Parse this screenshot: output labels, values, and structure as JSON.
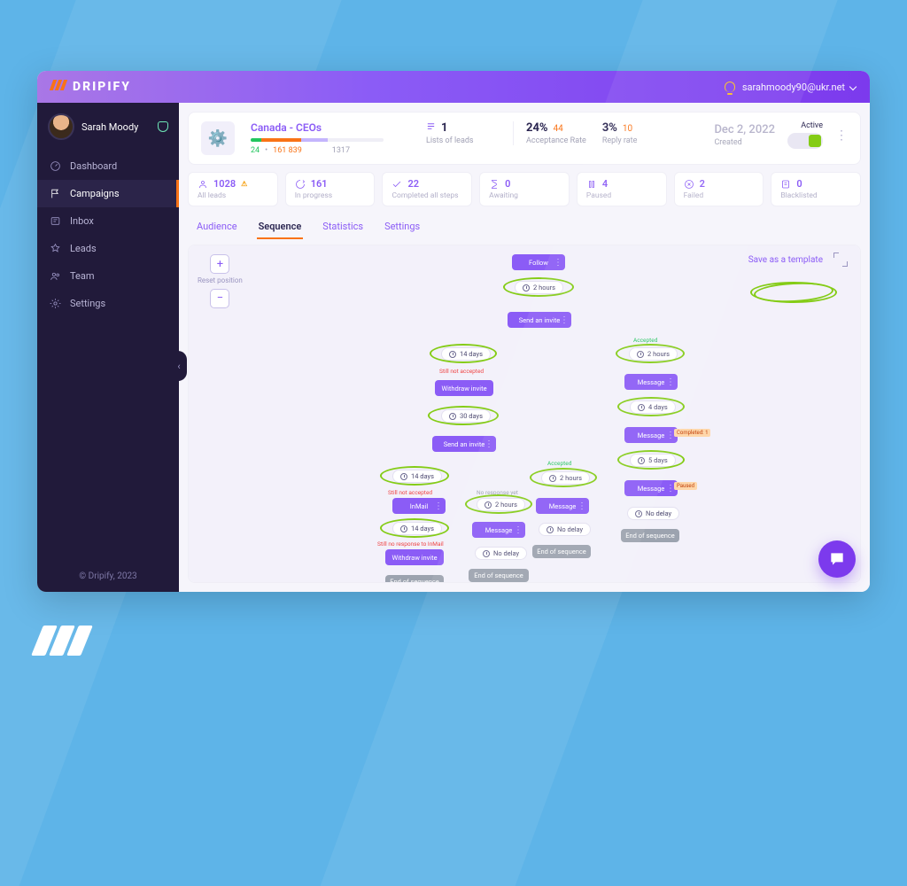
{
  "brand": "DRIPIFY",
  "user_email": "sarahmoody90@ukr.net",
  "profile": {
    "name": "Sarah Moody"
  },
  "sidebar": {
    "items": [
      {
        "label": "Dashboard"
      },
      {
        "label": "Campaigns"
      },
      {
        "label": "Inbox"
      },
      {
        "label": "Leads"
      },
      {
        "label": "Team"
      },
      {
        "label": "Settings"
      }
    ]
  },
  "copyright": "© Dripify, 2023",
  "campaign": {
    "title": "Canada - CEOs",
    "counts": {
      "green": "24",
      "orange": "161 839",
      "grey": "1317"
    },
    "lists": {
      "value": "1",
      "label": "Lists of leads"
    },
    "acceptance": {
      "pct": "24%",
      "sub": "44",
      "label": "Acceptance Rate"
    },
    "reply": {
      "pct": "3%",
      "sub": "10",
      "label": "Reply rate"
    },
    "created": {
      "date": "Dec 2, 2022",
      "label": "Created"
    },
    "status_label": "Active"
  },
  "chips": [
    {
      "value": "1028",
      "label": "All leads"
    },
    {
      "value": "161",
      "label": "In progress"
    },
    {
      "value": "22",
      "label": "Completed all steps"
    },
    {
      "value": "0",
      "label": "Awaiting"
    },
    {
      "value": "4",
      "label": "Paused"
    },
    {
      "value": "2",
      "label": "Failed"
    },
    {
      "value": "0",
      "label": "Blacklisted"
    }
  ],
  "tabs": [
    "Audience",
    "Sequence",
    "Statistics",
    "Settings"
  ],
  "canvas": {
    "reset_label": "Reset position",
    "save_template": "Save as a template"
  },
  "nodes": {
    "follow": "Follow",
    "d2h": "2 hours",
    "invite": "Send an invite",
    "accepted": "Accepted",
    "d14": "14 days",
    "not_accepted": "Still not accepted",
    "withdraw": "Withdraw invite",
    "d30": "30 days",
    "invite2": "Send an invite",
    "accepted2": "Accepted",
    "d14b": "14 days",
    "na2": "Still not accepted",
    "inmail": "InMail",
    "d14c": "14 days",
    "na3": "Still no response to InMail",
    "withdraw2": "Withdraw invite",
    "eos": "End of sequence",
    "nr2": "No response yet",
    "d2h2": "2 hours",
    "msg": "Message",
    "nodelay": "No delay",
    "eos2": "End of sequence",
    "r_accepted": "Accepted",
    "r2h": "2 hours",
    "rmsg1": "Message",
    "r4d": "4 days",
    "rmsg2": "Message",
    "r5d": "5 days",
    "rmsg3": "Message",
    "rnd": "No delay",
    "reos": "End of sequence",
    "mid2h": "2 hours",
    "midmsg": "Message",
    "midnd": "No delay",
    "mideos": "End of sequence",
    "completed_tag": "Completed: 1",
    "paused_tag": "Paused"
  }
}
